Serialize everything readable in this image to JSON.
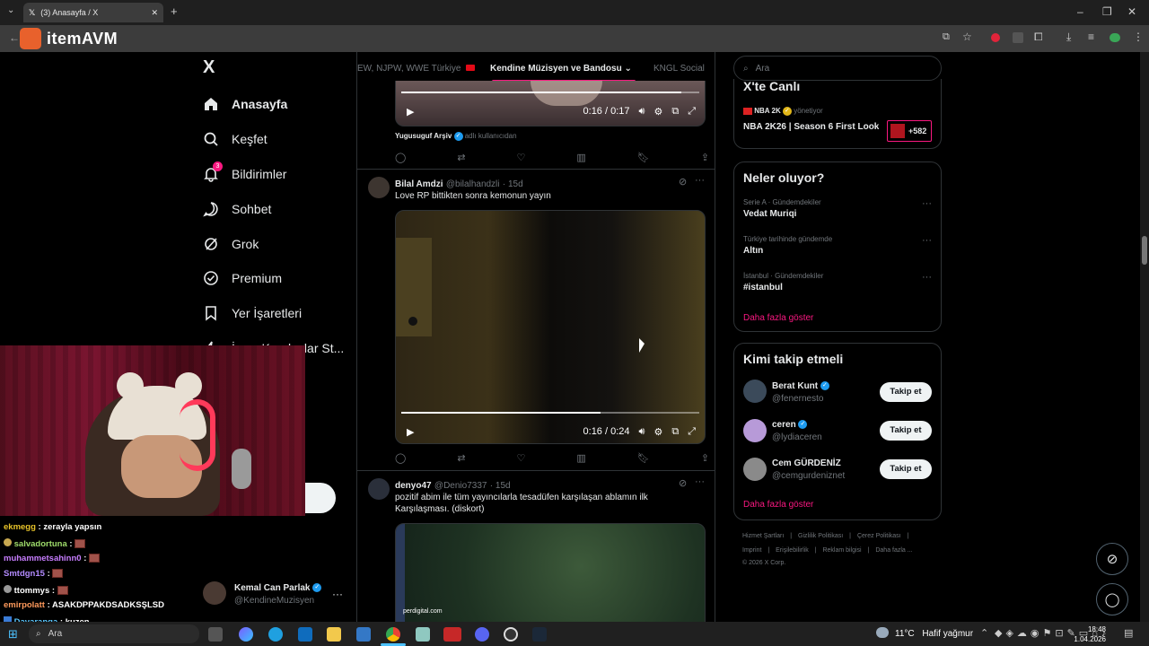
{
  "browser": {
    "tab_title": "(3) Anasayfa / X",
    "new_tab": "+",
    "watermark": "itemAVM",
    "window_controls": [
      "–",
      "❐",
      "✕"
    ]
  },
  "sidebar": {
    "logo": "X",
    "items": [
      {
        "label": "Anasayfa",
        "icon": "home-icon",
        "active": true
      },
      {
        "label": "Keşfet",
        "icon": "search-icon"
      },
      {
        "label": "Bildirimler",
        "icon": "bell-icon",
        "badge": "3"
      },
      {
        "label": "Sohbet",
        "icon": "chat-icon"
      },
      {
        "label": "Grok",
        "icon": "grok-icon"
      },
      {
        "label": "Premium",
        "icon": "premium-icon"
      },
      {
        "label": "Yer İşaretleri",
        "icon": "bookmark-icon"
      },
      {
        "label": "İş ve Kuruluşlar St...",
        "icon": "lightning-icon"
      }
    ],
    "account": {
      "name": "Kemal Can Parlak",
      "handle": "@KendineMuzisyen",
      "more": "···"
    }
  },
  "feed": {
    "tabs": [
      "EW, NJPW, WWE Türkiye",
      "Kendine Müzisyen ve Bandosu",
      "KNGL Social"
    ],
    "active_tab": 1,
    "tweets": [
      {
        "video_time": "0:16 / 0:17",
        "progress": 0.94,
        "source": "Yugusuguf Arşiv",
        "source_suffix": "adlı kullanıcıdan"
      },
      {
        "author": "Bilal Amdzi",
        "handle": "@bilalhandzli",
        "time": "· 15d",
        "text": "Love RP bittikten sonra kemonun yayın",
        "video_time": "0:16 / 0:24",
        "progress": 0.67
      },
      {
        "author": "denyo47",
        "handle": "@Denio7337",
        "time": "· 15d",
        "text": "pozitif abim ile tüm yayıncılarla tesadüfen karşılaşan ablamın ilk Karşılaşması. (diskort)",
        "video_watermark": "perdigital.com"
      }
    ]
  },
  "right": {
    "search_placeholder": "Ara",
    "live": {
      "title": "X'te Canlı",
      "host": "NBA 2K",
      "host_suffix": "yönetiyor",
      "stream_title": "NBA 2K26 | Season 6 First Look",
      "viewers": "+582"
    },
    "trends": {
      "title": "Neler oluyor?",
      "items": [
        {
          "category": "Serie A · Gündemdekiler",
          "name": "Vedat Muriqi"
        },
        {
          "category": "Türkiye tarihinde gündemde",
          "name": "Altın"
        },
        {
          "category": "İstanbul · Gündemdekiler",
          "name": "#istanbul"
        }
      ],
      "show_more": "Daha fazla göster"
    },
    "who_to_follow": {
      "title": "Kimi takip etmeli",
      "users": [
        {
          "name": "Berat Kunt",
          "handle": "@fenernesto"
        },
        {
          "name": "ceren",
          "handle": "@lydiaceren"
        },
        {
          "name": "Cem GÜRDENİZ",
          "handle": "@cemgurdeniznet"
        }
      ],
      "follow_label": "Takip et",
      "show_more": "Daha fazla göster"
    },
    "footer": {
      "line1": [
        "Hizmet Şartları",
        "|",
        "Gizlilik Politikası",
        "|",
        "Çerez Politikası",
        "|"
      ],
      "line2": [
        "Imprint",
        "|",
        "Erişilebilirlik",
        "|",
        "Reklam bilgisi",
        "|",
        "Daha fazla ..."
      ],
      "copyright": "© 2026 X Corp."
    }
  },
  "chat": [
    {
      "user": "ekmegg",
      "color": "#e6c229",
      "msg": "zerayla yapsın",
      "emote": false
    },
    {
      "user": "salvadortuna",
      "color": "#9fdc6b",
      "msg": "",
      "emote": true
    },
    {
      "user": "muhammetsahinn0",
      "color": "#c77dff",
      "msg": "",
      "emote": true
    },
    {
      "user": "Smtdgn15",
      "color": "#b38bff",
      "msg": "",
      "emote": true
    },
    {
      "user": "ttommys",
      "color": "#ffffff",
      "msg": "",
      "emote": true
    },
    {
      "user": "emirpolatt",
      "color": "#ff9a5c",
      "msg": "ASAKDPPAKDSADKSŞLSD",
      "emote": false
    },
    {
      "user": "Davaranga",
      "color": "#5cc8ff",
      "msg": "kuzen",
      "emote": false
    }
  ],
  "taskbar": {
    "search_placeholder": "Ara",
    "weather": "11°C",
    "weather_text": "Hafif yağmur",
    "time": "18:48",
    "date": "1.04.2026"
  }
}
